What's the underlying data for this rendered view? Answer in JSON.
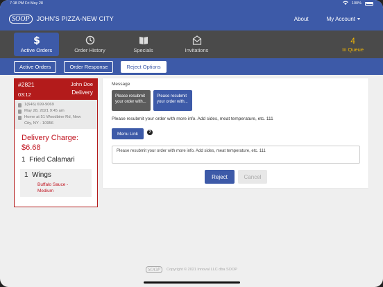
{
  "status_bar": {
    "time": "7:18 PM",
    "date": "Fri May 28",
    "battery": "100%"
  },
  "navbar": {
    "logo": "SOOP",
    "brand": "JOHN'S PIZZA-NEW CITY",
    "about": "About",
    "account": "My Account"
  },
  "tabs": [
    {
      "label": "Active Orders",
      "icon": "dollar-icon",
      "active": true
    },
    {
      "label": "Order History",
      "icon": "clock-icon",
      "active": false
    },
    {
      "label": "Specials",
      "icon": "book-icon",
      "active": false
    },
    {
      "label": "Invitations",
      "icon": "envelope-icon",
      "active": false
    }
  ],
  "queue": {
    "count": "4",
    "label": "In Queue",
    "color": "#f2b705"
  },
  "subtabs": {
    "active_orders": "Active Orders",
    "order_response": "Order Response",
    "reject_options": "Reject Options"
  },
  "order": {
    "number": "#2821",
    "time": "03:12",
    "customer": "John Doe",
    "type": "Delivery",
    "phone": "1(646) 699-9069",
    "date": "May 28, 2021 9:45 am",
    "address_line1": "Home at 51 Woodbine Rd, New",
    "address_line2": "City, NY - 10956",
    "charge_label": "Delivery Charge:",
    "charge_value": "$6.68",
    "items": [
      {
        "qty": "1",
        "name": "Fried Calamari"
      },
      {
        "qty": "1",
        "name": "Wings",
        "modifier_line1": "Buffalo Sauce -",
        "modifier_line2": "Medium"
      }
    ]
  },
  "reject_panel": {
    "message_label": "Message",
    "msg_option_1_line1": "Please resubmit",
    "msg_option_1_line2": "your order with...",
    "msg_option_2_line1": "Please resubmit",
    "msg_option_2_line2": "your order with...",
    "selected_text": "Please resubmit your order with more info. Add sides, meat temperature, etc. 111",
    "menu_link": "Menu Link",
    "help": "?",
    "textarea_value": "Please resubmit your order with more info. Add sides, meat temperature, etc. 111",
    "reject": "Reject",
    "cancel": "Cancel"
  },
  "footer": {
    "logo": "SOOP",
    "copyright": "Copyright © 2021 Innoval LLC dba SOOP"
  },
  "colors": {
    "primary": "#3d5aa8",
    "alert": "#b31b1b",
    "queue": "#f2b705"
  }
}
